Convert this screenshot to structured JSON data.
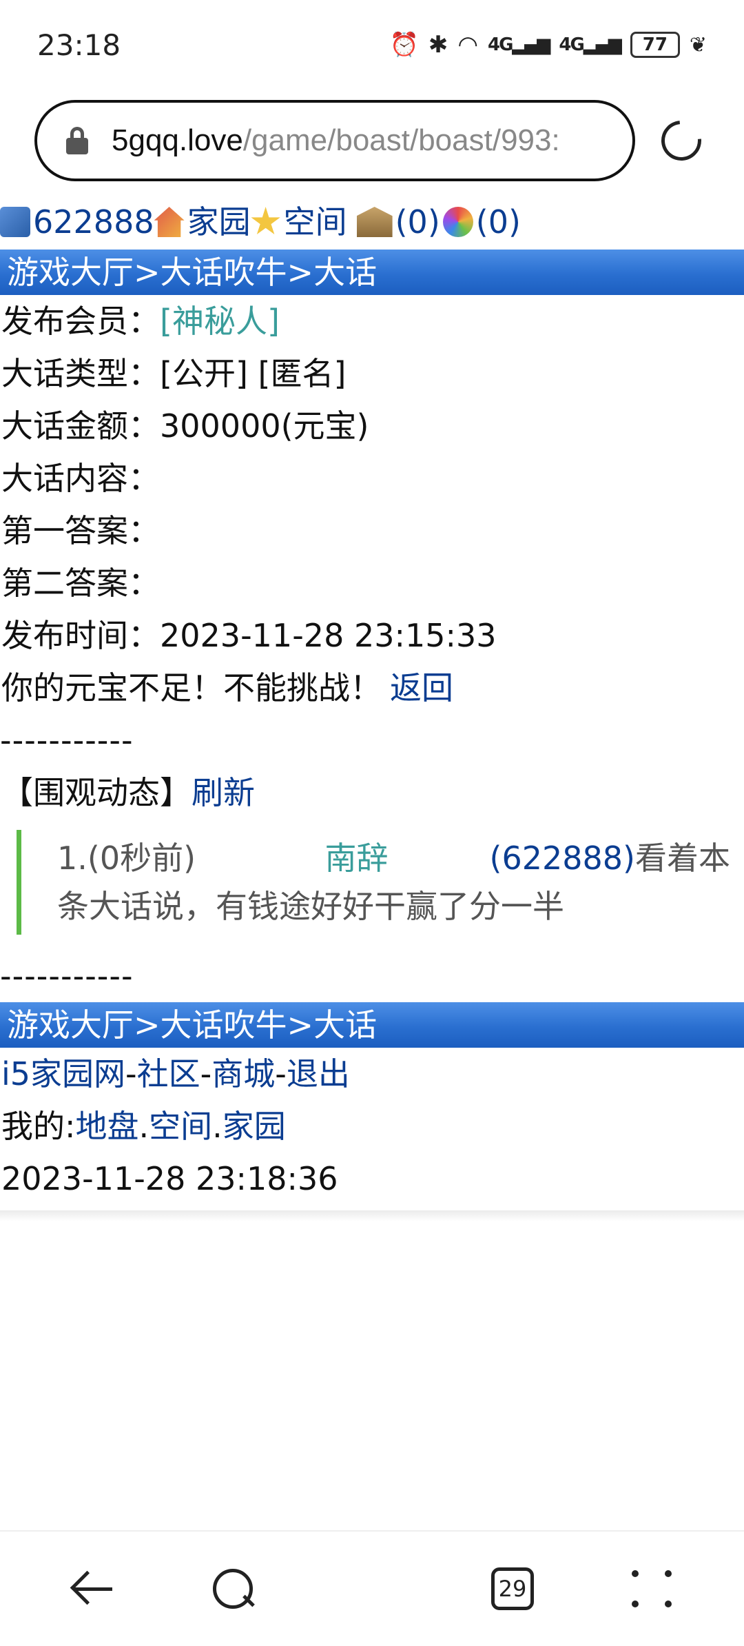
{
  "status_bar": {
    "time": "23:18",
    "signal_1": "4G",
    "signal_2": "4G",
    "battery": "77",
    "icons": [
      "alarm-icon",
      "bluetooth-icon",
      "wifi-icon",
      "signal-icon",
      "signal-icon",
      "battery-icon",
      "leaf-icon"
    ]
  },
  "browser": {
    "url_host": "5gqq.love",
    "url_path": "/game/boast/boast/993:"
  },
  "top_nav": {
    "user_id": "622888",
    "home_label": "家园",
    "space_label": "空间",
    "bank_count": "(0)",
    "color_count": "(0)"
  },
  "breadcrumb": {
    "lobby": "游戏大厅",
    "sep1": ">",
    "boast": "大话吹牛",
    "sep2": ">",
    "current": "大话"
  },
  "details": {
    "publisher_label": "发布会员：",
    "publisher_value": "[神秘人]",
    "type_label": "大话类型：",
    "type_value": "[公开] [匿名]",
    "amount_label": "大话金额：",
    "amount_value": "300000(元宝)",
    "content_label": "大话内容：",
    "answer1_label": "第一答案：",
    "answer2_label": "第二答案：",
    "time_label": "发布时间：",
    "time_value": "2023-11-28 23:15:33",
    "error_message": "你的元宝不足！不能挑战！",
    "back_link": "返回"
  },
  "divider": "-----------",
  "activity": {
    "title": "【围观动态】",
    "refresh_link": "刷新",
    "items": [
      {
        "prefix": "1.(0秒前)",
        "name": "南辞",
        "uid": "(622888)",
        "text_line1": "看着本",
        "text_line2": "条大话说，有钱途好好干赢了分一半"
      }
    ]
  },
  "footer": {
    "links": [
      "i5家园网",
      "社区",
      "商城",
      "退出"
    ],
    "link_sep": "-",
    "mine_label": "我的:",
    "mine_links": [
      "地盘",
      "空间",
      "家园"
    ],
    "mine_sep": ".",
    "timestamp": "2023-11-28 23:18:36"
  },
  "bottom_nav": {
    "tab_count": "29"
  }
}
